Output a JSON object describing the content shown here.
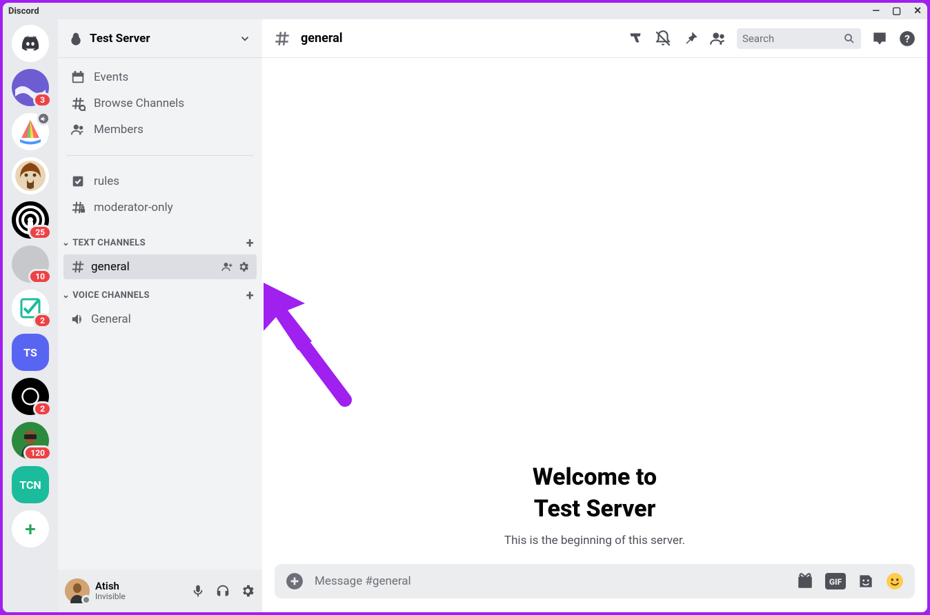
{
  "titlebar": {
    "app_name": "Discord"
  },
  "guilds": {
    "items": [
      {
        "type": "home"
      },
      {
        "type": "img",
        "bg": "#6c5dd3",
        "badge": "3"
      },
      {
        "type": "img",
        "bg": "#ffffff",
        "muted": true
      },
      {
        "type": "img",
        "bg": "#ffffff"
      },
      {
        "type": "img",
        "bg": "#000000",
        "badge": "25"
      },
      {
        "type": "img",
        "bg": "#c7c8cc",
        "badge": "10"
      },
      {
        "type": "img",
        "bg": "#ffffff",
        "badge": "2"
      },
      {
        "type": "text",
        "bg": "#5865f2",
        "label": "TS"
      },
      {
        "type": "img",
        "bg": "#000000",
        "badge": "2"
      },
      {
        "type": "img",
        "bg": "#2b8a3e",
        "badge": "120"
      },
      {
        "type": "text",
        "bg": "#1abc9c",
        "label": "TCN"
      },
      {
        "type": "add"
      }
    ]
  },
  "server": {
    "name": "Test Server",
    "nav": [
      {
        "icon": "events",
        "label": "Events"
      },
      {
        "icon": "browse",
        "label": "Browse Channels"
      },
      {
        "icon": "members",
        "label": "Members"
      }
    ],
    "pinned": [
      {
        "icon": "rules",
        "label": "rules"
      },
      {
        "icon": "hashlock",
        "label": "moderator-only"
      }
    ],
    "categories": [
      {
        "name": "TEXT CHANNELS",
        "channels": [
          {
            "icon": "hash",
            "label": "general",
            "active": true
          }
        ]
      },
      {
        "name": "VOICE CHANNELS",
        "channels": [
          {
            "icon": "speaker",
            "label": "General",
            "active": false
          }
        ]
      }
    ]
  },
  "user": {
    "name": "Atish",
    "status": "Invisible"
  },
  "topbar": {
    "channel_name": "general",
    "search_placeholder": "Search"
  },
  "welcome": {
    "line1": "Welcome to",
    "line2": "Test Server",
    "subtitle": "This is the beginning of this server."
  },
  "composer": {
    "placeholder": "Message #general"
  }
}
